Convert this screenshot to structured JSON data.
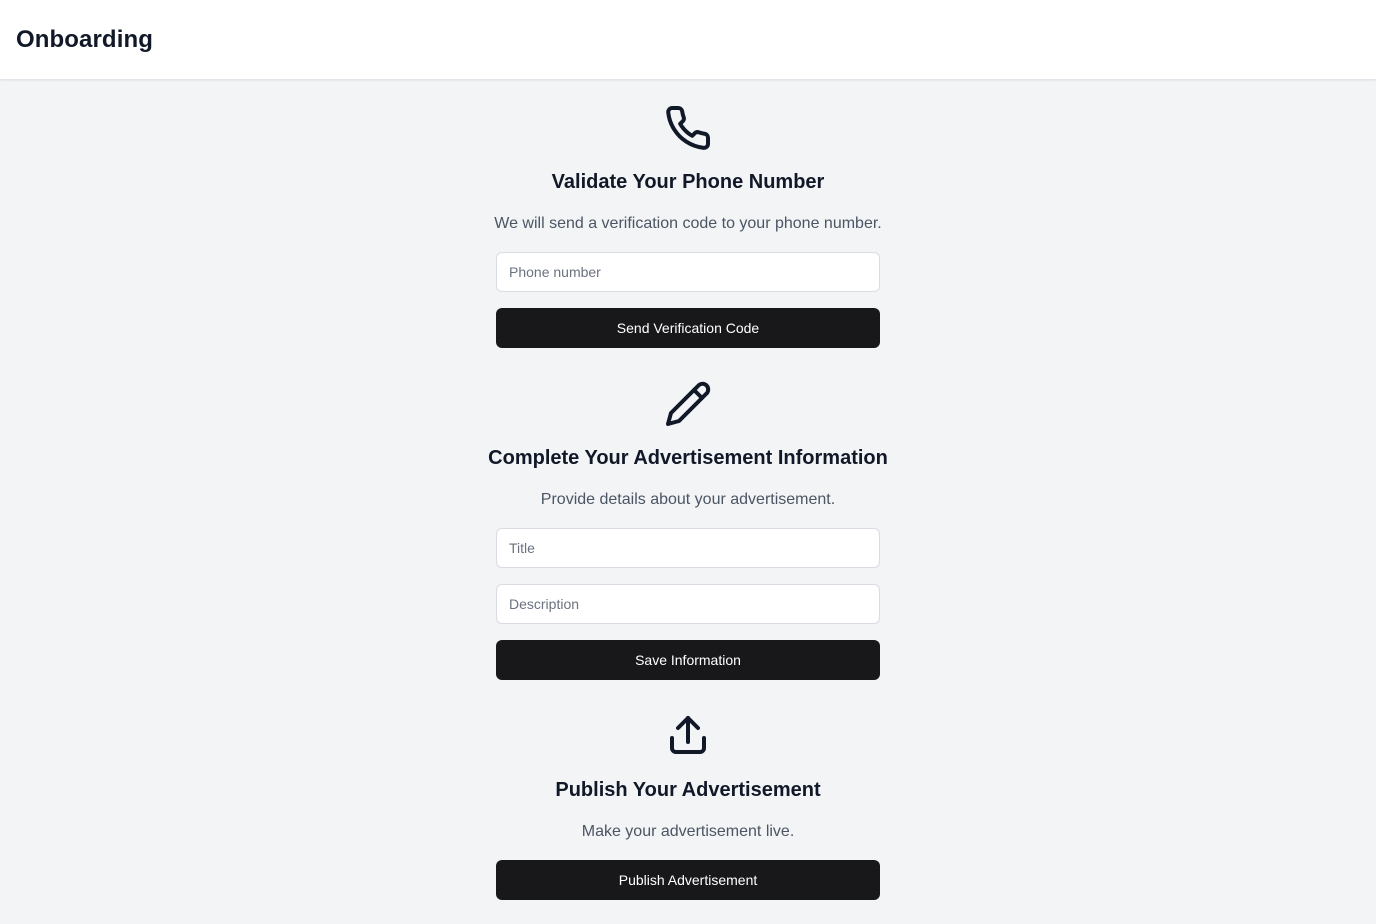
{
  "header": {
    "title": "Onboarding"
  },
  "steps": [
    {
      "icon": "phone-icon",
      "title": "Validate Your Phone Number",
      "description": "We will send a verification code to your phone number.",
      "inputs": [
        {
          "placeholder": "Phone number",
          "value": ""
        }
      ],
      "button": "Send Verification Code"
    },
    {
      "icon": "pencil-icon",
      "title": "Complete Your Advertisement Information",
      "description": "Provide details about your advertisement.",
      "inputs": [
        {
          "placeholder": "Title",
          "value": ""
        },
        {
          "placeholder": "Description",
          "value": ""
        }
      ],
      "button": "Save Information"
    },
    {
      "icon": "upload-icon",
      "title": "Publish Your Advertisement",
      "description": "Make your advertisement live.",
      "inputs": [],
      "button": "Publish Advertisement"
    }
  ],
  "colors": {
    "background": "#f2f4f6",
    "header_background": "#ffffff",
    "button_background": "#18181b",
    "button_text": "#ffffff",
    "heading_text": "#111827",
    "description_text": "#4b5563"
  }
}
